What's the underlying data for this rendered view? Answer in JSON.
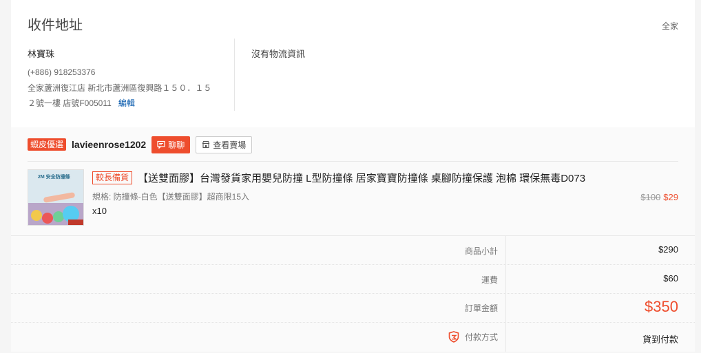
{
  "address": {
    "title": "收件地址",
    "carrier": "全家",
    "recipient": "林寶珠",
    "phone": "(+886) 918253376",
    "line1": "全家蘆洲復江店 新北市蘆洲區復興路１５０．１５",
    "line2": "２號一樓 店號F005011",
    "edit_label": "編輯",
    "logistics": "沒有物流資訊"
  },
  "shop": {
    "badge": "蝦皮優選",
    "name": "lavieenrose1202",
    "chat_label": "聊聊",
    "view_shop_label": "查看賣場"
  },
  "product": {
    "badge": "較長備貨",
    "name": "【送雙面膠】台灣發貨家用嬰兒防撞 L型防撞條 居家寶寶防撞條 桌腳防撞保護 泡棉 環保無毒D073",
    "variation": "規格: 防撞條-白色【送雙面膠】超商限15入",
    "quantity": "x10",
    "original_price": "$100",
    "price": "$29",
    "image_text": "2M 安全防撞條"
  },
  "summary": {
    "subtotal_label": "商品小計",
    "subtotal_value": "$290",
    "shipping_label": "運費",
    "shipping_value": "$60",
    "total_label": "訂單金額",
    "total_value": "$350",
    "payment_label": "付款方式",
    "payment_value": "貨到付款"
  },
  "colors": {
    "accent": "#ee4d2d",
    "link": "#0055aa"
  },
  "icons": [
    "chat-icon",
    "shop-icon",
    "shield-icon"
  ]
}
